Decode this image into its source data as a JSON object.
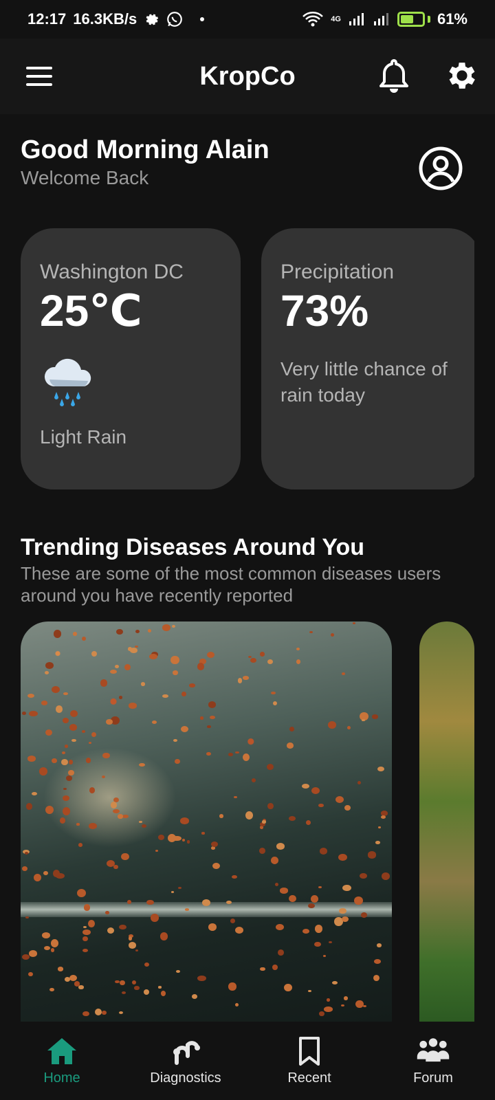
{
  "status_bar": {
    "time": "12:17",
    "speed": "16.3KB/s",
    "network": "4G",
    "battery": "61%",
    "battery_level": 0.61
  },
  "app_bar": {
    "title": "KropCo"
  },
  "greeting": {
    "title": "Good Morning Alain",
    "subtitle": "Welcome Back"
  },
  "weather": {
    "location": "Washington DC",
    "temperature": "25℃",
    "condition": "Light Rain",
    "icon": "rain-cloud-icon"
  },
  "precipitation": {
    "label": "Precipitation",
    "value": "73%",
    "description": "Very little chance of rain today"
  },
  "trending": {
    "title": "Trending Diseases Around You",
    "description": "These are some of the most common diseases users around you have recently reported"
  },
  "bottom_nav": {
    "items": [
      {
        "label": "Home",
        "icon": "home-icon",
        "active": true
      },
      {
        "label": "Diagnostics",
        "icon": "diagnostics-icon",
        "active": false
      },
      {
        "label": "Recent",
        "icon": "bookmark-icon",
        "active": false
      },
      {
        "label": "Forum",
        "icon": "forum-icon",
        "active": false
      }
    ]
  },
  "colors": {
    "background": "#121212",
    "card": "#333333",
    "accent": "#1a9b7e",
    "battery": "#9ee04a"
  }
}
